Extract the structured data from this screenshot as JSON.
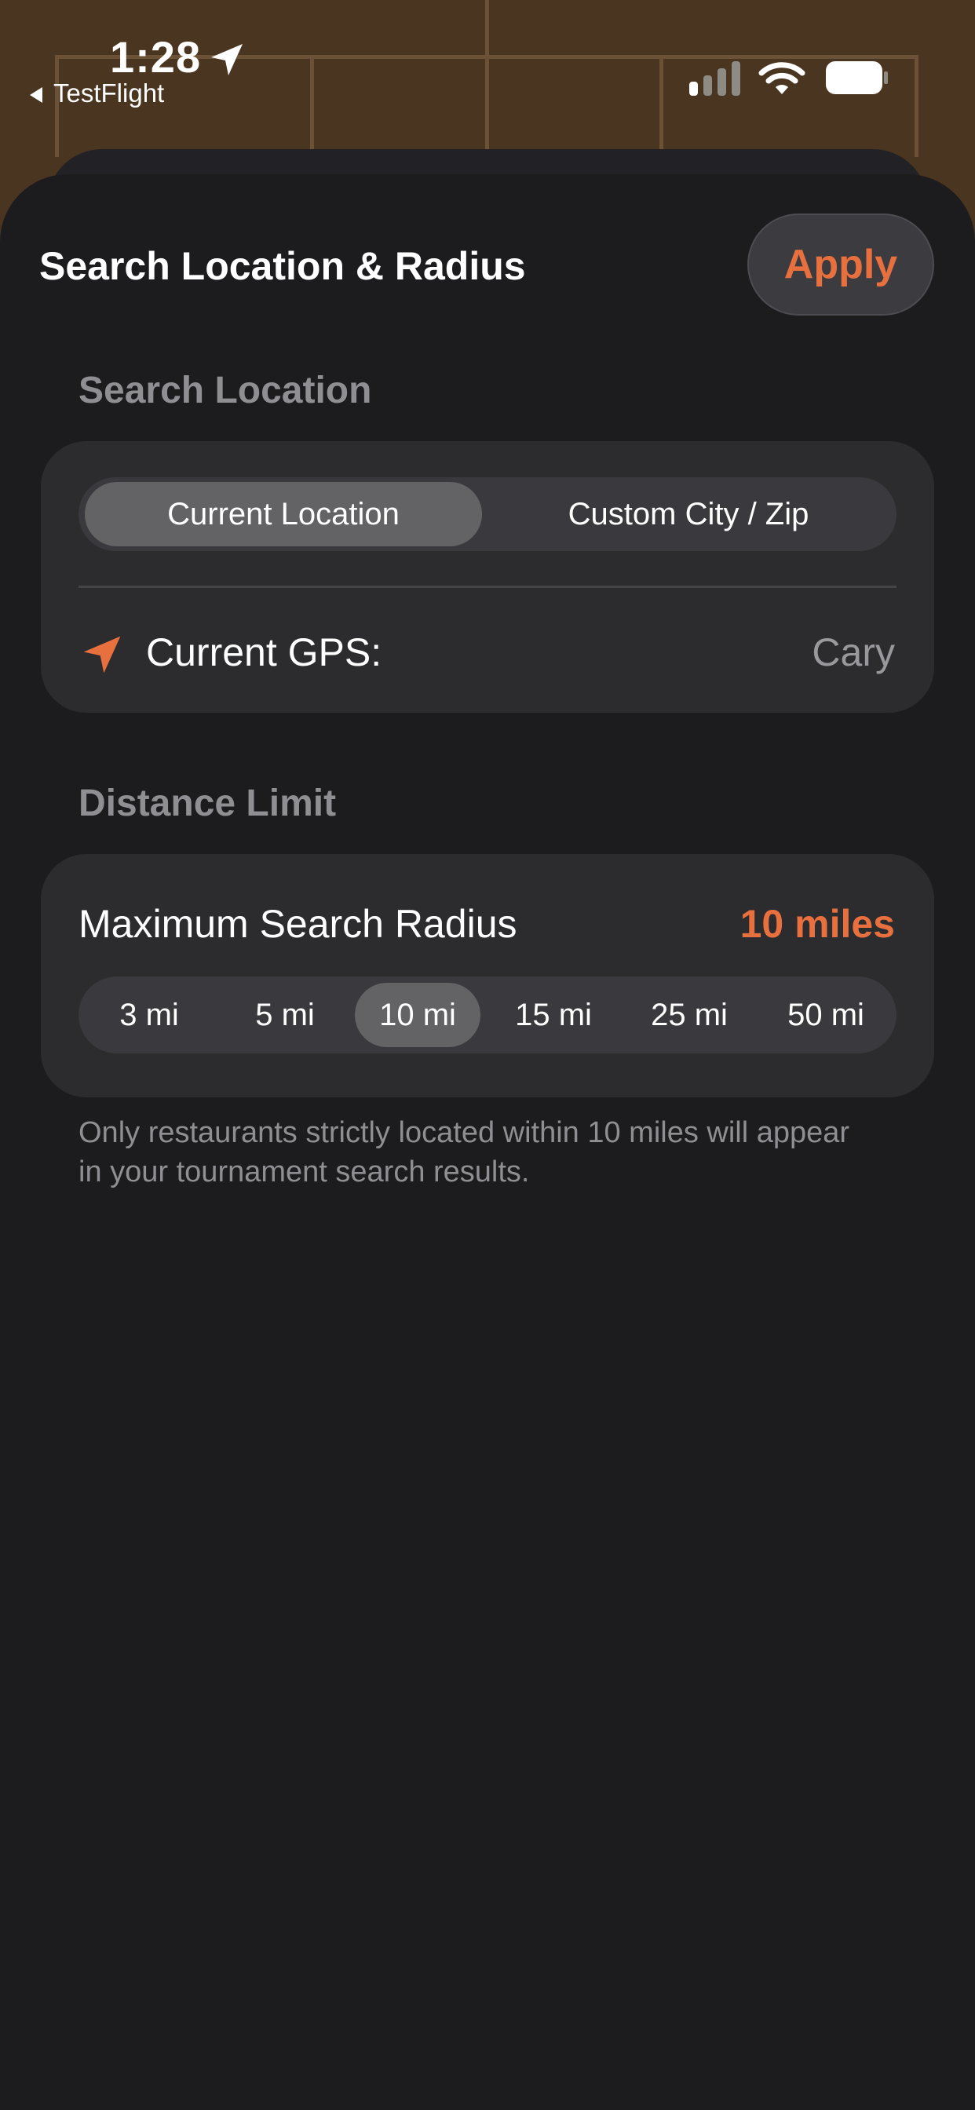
{
  "status_bar": {
    "time": "1:28",
    "back_app": "TestFlight",
    "icons": [
      "location-arrow-icon",
      "cellular-signal-icon",
      "wifi-icon",
      "battery-icon"
    ]
  },
  "sheet": {
    "title": "Search Location & Radius",
    "apply_label": "Apply"
  },
  "search_location": {
    "section_label": "Search Location",
    "segments": [
      {
        "label": "Current Location",
        "selected": true
      },
      {
        "label": "Custom City / Zip",
        "selected": false
      }
    ],
    "gps_label": "Current GPS:",
    "gps_value": "Cary",
    "gps_icon": "location-arrow-icon"
  },
  "distance_limit": {
    "section_label": "Distance Limit",
    "radius_label": "Maximum Search Radius",
    "radius_value": "10 miles",
    "options": [
      {
        "label": "3 mi",
        "selected": false
      },
      {
        "label": "5 mi",
        "selected": false
      },
      {
        "label": "10 mi",
        "selected": true
      },
      {
        "label": "15 mi",
        "selected": false
      },
      {
        "label": "25 mi",
        "selected": false
      },
      {
        "label": "50 mi",
        "selected": false
      }
    ],
    "footnote": "Only restaurants strictly located within 10 miles will appear in your tournament search results."
  },
  "colors": {
    "accent": "#e8703e",
    "background": "#4a3520",
    "sheet": "#1c1c1e",
    "card": "#2c2c2f"
  }
}
